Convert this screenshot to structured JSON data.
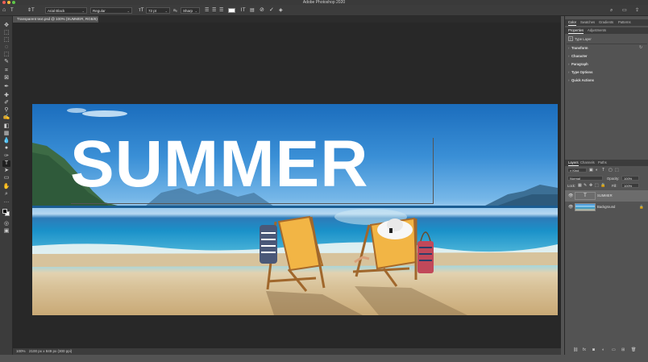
{
  "app": {
    "title": "Adobe Photoshop 2020"
  },
  "options_bar": {
    "font_family": "Arial Black",
    "font_style": "Regular",
    "font_size": "72 pt",
    "antialias": "Sharp",
    "aa_prefix": "aₐ"
  },
  "document": {
    "tab_label": "Transparent text.psd @ 100% (SUMMER, RGB/8) *",
    "close_glyph": "×",
    "canvas_text": "SUMMER"
  },
  "status": {
    "zoom": "100%",
    "doc_info": "2100 px x 849 px (300 ppi)"
  },
  "panels": {
    "top_tabs": [
      "Color",
      "Swatches",
      "Gradients",
      "Patterns"
    ],
    "mid_tabs": [
      "Properties",
      "Adjustments"
    ],
    "properties_header": "Type Layer",
    "sections": [
      "Transform",
      "Character",
      "Paragraph",
      "Type Options",
      "Quick Actions"
    ],
    "layers_tabs": [
      "Layers",
      "Channels",
      "Paths"
    ],
    "kind_filter": "Kind",
    "blend_mode": "Normal",
    "opacity_label": "Opacity:",
    "opacity_value": "100%",
    "lock_label": "Lock:",
    "fill_label": "Fill:",
    "fill_value": "100%",
    "layers": [
      {
        "name": "SUMMER",
        "type": "text",
        "selected": true
      },
      {
        "name": "Background",
        "type": "image",
        "selected": false
      }
    ]
  },
  "colors": {
    "foreground": "#000000",
    "background": "#ffffff"
  }
}
